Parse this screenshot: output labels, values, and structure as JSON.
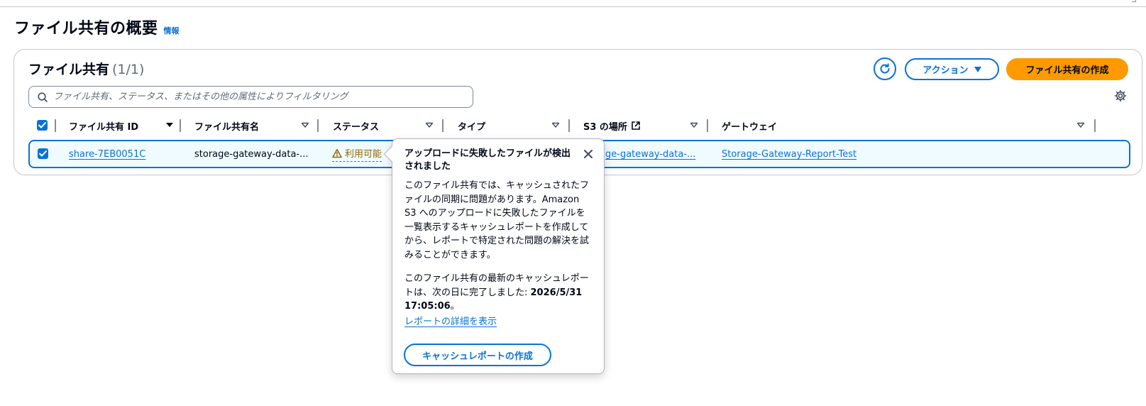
{
  "page": {
    "title": "ファイル共有の概要",
    "info_label": "情報"
  },
  "table": {
    "title": "ファイル共有",
    "count": "(1/1)",
    "search_placeholder": "ファイル共有、ステータス、またはその他の属性によりフィルタリング",
    "actions": {
      "refresh_icon": "refresh-icon",
      "action_label": "アクション",
      "create_label": "ファイル共有の作成"
    },
    "columns": [
      "ファイル共有 ID",
      "ファイル共有名",
      "ステータス",
      "タイプ",
      "S3 の場所",
      "ゲートウェイ"
    ],
    "rows": [
      {
        "selected": true,
        "id": "share-7EB0051C",
        "name": "storage-gateway-data-...",
        "status": "利用可能",
        "type": "",
        "s3_location": "ge-gateway-data-...",
        "gateway": "Storage-Gateway-Report-Test"
      }
    ]
  },
  "popover": {
    "title": "アップロードに失敗したファイルが検出されました",
    "paragraph1": "このファイル共有では、キャッシュされたファイルの同期に問題があります。Amazon S3 へのアップロードに失敗したファイルを一覧表示するキャッシュレポートを作成してから、レポートで特定された問題の解決を試みることができます。",
    "paragraph2_prefix": "このファイル共有の最新のキャッシュレポートは、次の日に完了しました: ",
    "paragraph2_date": "2026/5/31 17:05:06",
    "paragraph2_suffix": "。",
    "report_link": "レポートの詳細を表示",
    "button_label": "キャッシュレポートの作成"
  },
  "colors": {
    "link": "#0972d3",
    "primary_button": "#ff9900",
    "warning_text": "#8d6605",
    "selected_row_bg": "#f0fbff"
  }
}
